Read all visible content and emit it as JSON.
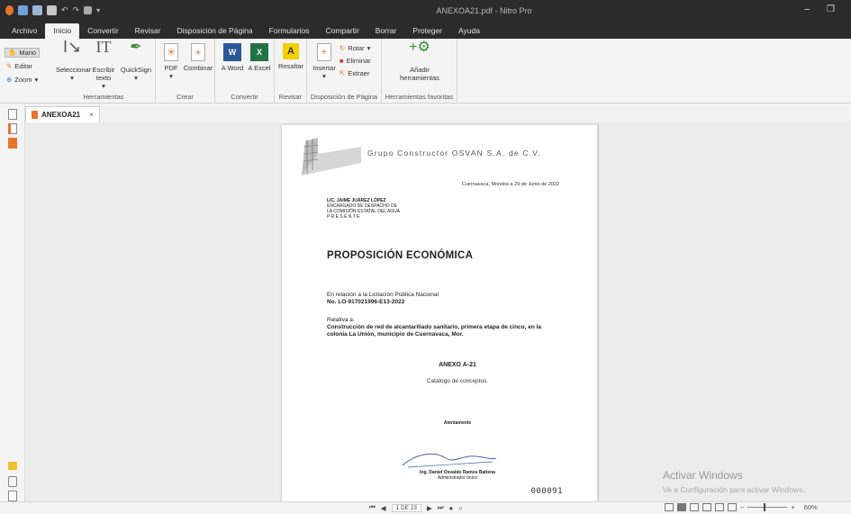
{
  "window": {
    "title": "ANEXOA21.pdf - Nitro Pro",
    "minimize": "−",
    "restore": "❒"
  },
  "menu": {
    "tabs": [
      "Archivo",
      "Inicio",
      "Convertir",
      "Revisar",
      "Disposición de Página",
      "Formularios",
      "Compartir",
      "Borrar",
      "Proteger",
      "Ayuda"
    ],
    "active": "Inicio"
  },
  "ribbon": {
    "mano": "Mano",
    "editar": "Editar",
    "zoom": "Zoom",
    "herramientas": {
      "label": "Herramientas",
      "seleccionar": "Seleccionar",
      "escribir": "Escribir texto",
      "quicksign": "QuickSign"
    },
    "crear": {
      "label": "Crear",
      "pdf": "PDF",
      "combinar": "Combinar"
    },
    "convertir": {
      "label": "Convertir",
      "word": "A Word",
      "excel": "A Excel"
    },
    "revisar": {
      "label": "Revisar",
      "resaltar": "Resaltar"
    },
    "disposicion": {
      "label": "Disposición de Página",
      "insertar": "Insertar",
      "rotar": "Rotar",
      "eliminar": "Eliminar",
      "extraer": "Extraer"
    },
    "favoritas": {
      "label": "Herramientas favoritas",
      "anadir": "Añadir herramientas"
    }
  },
  "doc_tab": {
    "name": "ANEXOA21",
    "close": "×"
  },
  "document": {
    "company": "Grupo Constructor OSVAN S.A. de C.V.",
    "date": "Cuernavaca, Morelos a 29 de Junio de 2022",
    "addressee": "LIC. JAIME JUÁREZ LÓPEZ",
    "addr1": "ENCARGADO DE DESPACHO DE",
    "addr2": "LA COMISIÓN ESTATAL DEL AGUA",
    "addr3": "P R E S E N T E",
    "title": "PROPOSICIÓN ECONÓMICA",
    "rel1": "En relación a la Licitación Pública Nacional",
    "rel2": "No. LO-917021996-E13-2022",
    "relativa": "Relativa a:",
    "subject": "Construcción de red de alcantarillado sanitario, primera etapa de cinco, en la colonia La Unión, municipio de Cuernavaca, Mor.",
    "anexo": "ANEXO A-21",
    "catalogo": "Catálogo de conceptos.",
    "atentamente": "Atentamente",
    "signer": "Ing. Daniel Osvaldo Ramos Bahena",
    "signer_role": "Administrador único",
    "folio": "000091"
  },
  "watermark": {
    "line1": "Activar Windows",
    "line2": "Ve a Configuración para activar Windows."
  },
  "status": {
    "page": "1 DE 23",
    "zoom": "60%"
  },
  "colors": {
    "titlebar": "#2b2b2b",
    "ribbon": "#f4f4f4",
    "accent_orange": "#e8742c",
    "word_blue": "#2b5797",
    "excel_green": "#217346"
  }
}
